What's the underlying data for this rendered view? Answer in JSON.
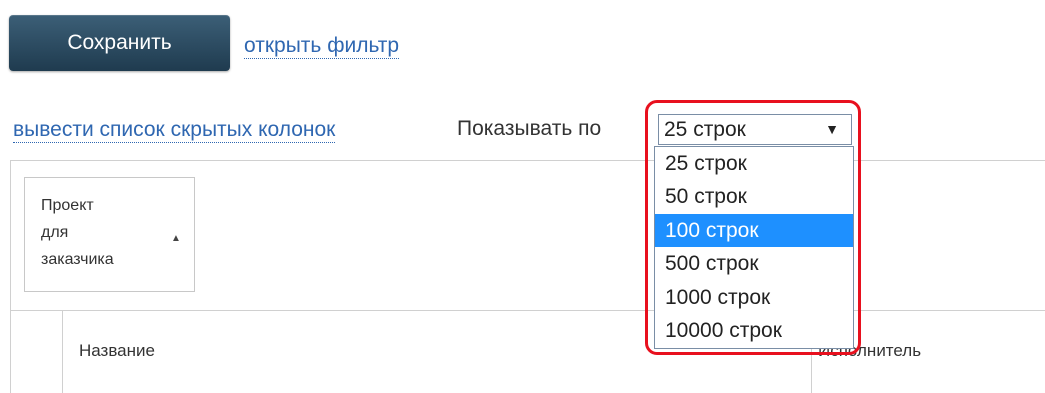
{
  "toolbar": {
    "save_label": "Сохранить",
    "filter_link": "открыть фильтр"
  },
  "controls": {
    "hidden_columns_link": "вывести список скрытых колонок",
    "show_per_page_label": "Показывать по",
    "rows_select": {
      "selected": "25 строк",
      "arrow": "▼",
      "options": [
        "25 строк",
        "50 строк",
        "100 строк",
        "500 строк",
        "1000 строк",
        "10000 строк"
      ],
      "highlighted_option": "100 строк"
    }
  },
  "table": {
    "group_header": "Проект\nдля\nзаказчика",
    "sort_icon": "▲",
    "columns": [
      "Название",
      "Исполнитель"
    ]
  },
  "colors": {
    "button": "#2b4a60",
    "link": "#2f67b1",
    "highlight_border": "#e8101e",
    "selected_option": "#1e90ff"
  }
}
